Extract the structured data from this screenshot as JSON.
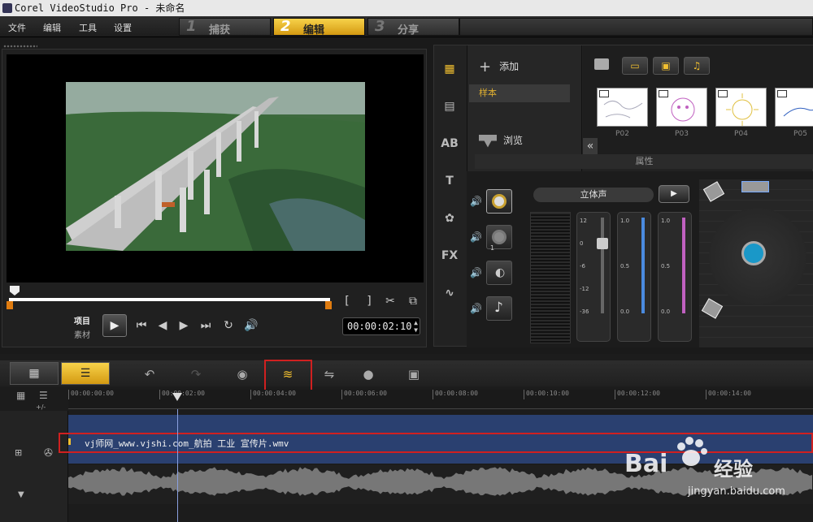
{
  "window": {
    "title": "Corel VideoStudio Pro - 未命名"
  },
  "menu": [
    "文件",
    "编辑",
    "工具",
    "设置"
  ],
  "steps": [
    {
      "num": "1",
      "label": "捕获",
      "active": false
    },
    {
      "num": "2",
      "label": "编辑",
      "active": true
    },
    {
      "num": "3",
      "label": "分享",
      "active": false
    }
  ],
  "player": {
    "mode_project": "项目",
    "mode_clip": "素材",
    "timecode": "00:00:02:10",
    "mark_in": "[",
    "mark_out": "]"
  },
  "library": {
    "add_label": "添加",
    "selected_item": "样本",
    "browse_label": "浏览",
    "thumbs": [
      "P02",
      "P03",
      "P04",
      "P05"
    ],
    "collapse": "«"
  },
  "properties": {
    "header": "属性",
    "stereo_label": "立体声",
    "fader1_scale": [
      "12",
      "6",
      "0",
      "-6",
      "-12",
      "-36"
    ],
    "fader2_scale": [
      "1.0",
      "0.5",
      "0.0"
    ],
    "fader3_scale": [
      "1.0",
      "0.5",
      "0.0"
    ],
    "mode_index": "1"
  },
  "timeline": {
    "ruler_ticks": [
      "00:00:00:00",
      "00:00:02:00",
      "00:00:04:00",
      "00:00:06:00",
      "00:00:08:00",
      "00:00:10:00",
      "00:00:12:00",
      "00:00:14:00"
    ],
    "clip_name": "vj师网_www.vjshi.com_航拍 工业 宣传片.wmv",
    "zoom_label": "+/-"
  },
  "watermark": {
    "brand": "Bai",
    "brand_cn": "经验",
    "url": "jingyan.baidu.com"
  },
  "colors": {
    "accent": "#f2c030",
    "highlight_box": "#d02020",
    "video_track": "#2a4070"
  }
}
